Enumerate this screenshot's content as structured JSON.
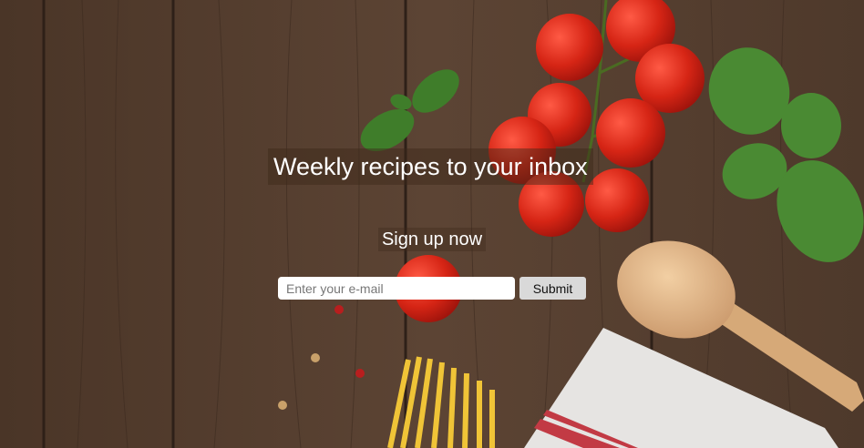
{
  "hero": {
    "title": "Weekly recipes to your inbox",
    "subtitle": "Sign up now"
  },
  "form": {
    "email_placeholder": "Enter your e-mail",
    "email_value": "",
    "submit_label": "Submit"
  },
  "colors": {
    "wood": "#5a4232",
    "tomato": "#d8281c",
    "basil": "#3f7d2a",
    "pasta": "#f0c437",
    "submit_bg": "#d9d9d9"
  }
}
